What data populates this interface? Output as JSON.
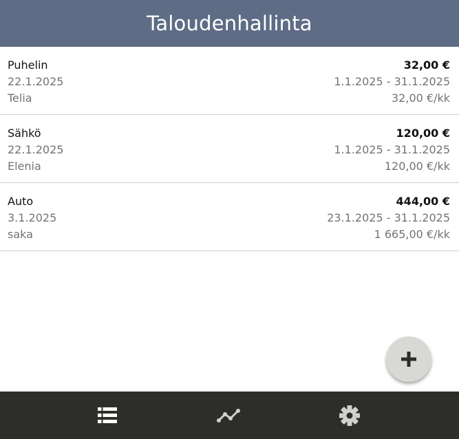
{
  "app": {
    "title": "Taloudenhallinta"
  },
  "expenses": [
    {
      "name": "Puhelin",
      "date": "22.1.2025",
      "vendor": "Telia",
      "amount": "32,00 €",
      "period": "1.1.2025 - 31.1.2025",
      "monthly": "32,00 €/kk"
    },
    {
      "name": "Sähkö",
      "date": "22.1.2025",
      "vendor": "Elenia",
      "amount": "120,00 €",
      "period": "1.1.2025 - 31.1.2025",
      "monthly": "120,00 €/kk"
    },
    {
      "name": "Auto",
      "date": "3.1.2025",
      "vendor": "saka",
      "amount": "444,00 €",
      "period": "23.1.2025 - 31.1.2025",
      "monthly": "1 665,00 €/kk"
    }
  ],
  "fab": {
    "icon": "plus-icon"
  },
  "bottom_nav": {
    "items": [
      {
        "icon": "list-icon",
        "selected": true
      },
      {
        "icon": "chart-line-icon",
        "selected": false
      },
      {
        "icon": "gear-icon",
        "selected": false
      }
    ]
  },
  "colors": {
    "header_bg": "#5f6c86",
    "nav_bg": "#2d2d29",
    "fab_bg": "#d8d8d5",
    "secondary_text": "#737373"
  }
}
